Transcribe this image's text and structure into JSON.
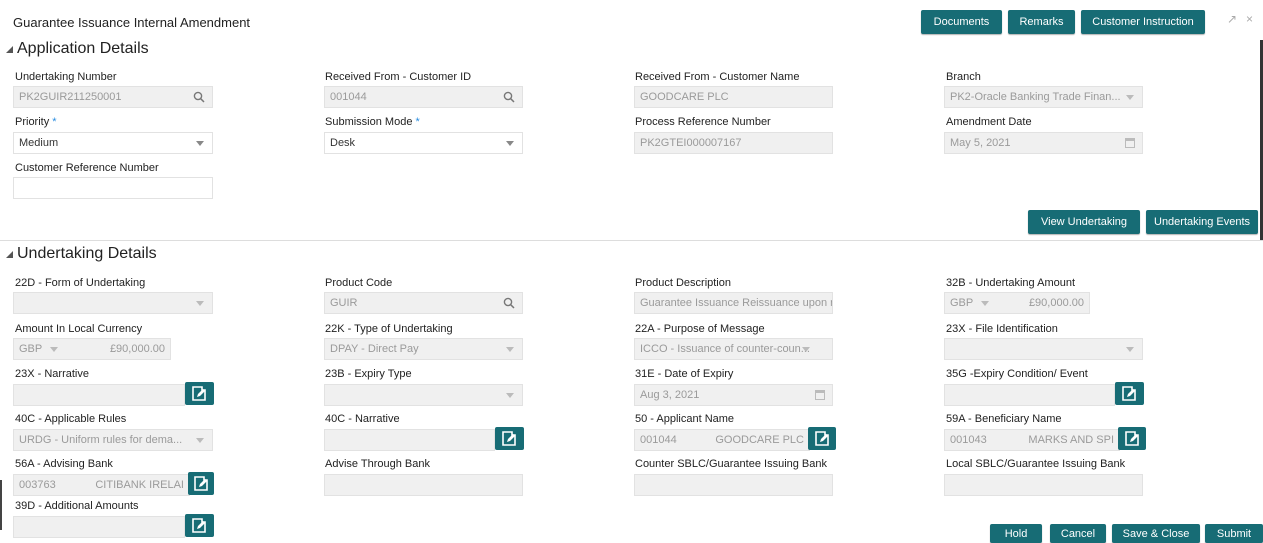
{
  "header": {
    "title": "Guarantee Issuance Internal Amendment",
    "buttons": [
      "Documents",
      "Remarks",
      "Customer Instruction"
    ],
    "win_icons": [
      "↗",
      "×"
    ]
  },
  "application": {
    "section_title": "Application Details",
    "undertaking_number": {
      "label": "Undertaking Number",
      "value": "PK2GUIR211250001"
    },
    "customer_id": {
      "label": "Received From - Customer ID",
      "value": "001044"
    },
    "customer_name": {
      "label": "Received From - Customer Name",
      "value": "GOODCARE PLC"
    },
    "branch": {
      "label": "Branch",
      "value": "PK2-Oracle Banking Trade Finan..."
    },
    "priority": {
      "label": "Priority",
      "required": "*",
      "value": "Medium"
    },
    "submission_mode": {
      "label": "Submission Mode",
      "required": "*",
      "value": "Desk"
    },
    "process_ref": {
      "label": "Process Reference Number",
      "value": "PK2GTEI000007167"
    },
    "amendment_date": {
      "label": "Amendment Date",
      "value": "May 5, 2021"
    },
    "customer_ref": {
      "label": "Customer Reference Number",
      "value": ""
    },
    "view_undertaking": "View Undertaking",
    "undertaking_events": "Undertaking Events"
  },
  "undertaking": {
    "section_title": "Undertaking Details",
    "form": {
      "label": "22D - Form of Undertaking",
      "value": ""
    },
    "product_code": {
      "label": "Product Code",
      "value": "GUIR"
    },
    "product_desc": {
      "label": "Product Description",
      "value": "Guarantee Issuance  Reissuance upon r"
    },
    "amount": {
      "label": "32B - Undertaking Amount",
      "currency": "GBP",
      "value": "£90,000.00"
    },
    "local_amount": {
      "label": "Amount In Local Currency",
      "currency": "GBP",
      "value": "£90,000.00"
    },
    "type": {
      "label": "22K - Type of Undertaking",
      "value": "DPAY - Direct Pay"
    },
    "purpose": {
      "label": "22A - Purpose of Message",
      "value": "ICCO - Issuance of counter-coun..."
    },
    "file_id": {
      "label": "23X - File Identification",
      "value": ""
    },
    "narrative_23x": {
      "label": "23X - Narrative"
    },
    "expiry_type": {
      "label": "23B - Expiry Type",
      "value": ""
    },
    "expiry_date": {
      "label": "31E - Date of Expiry",
      "value": "Aug 3, 2021"
    },
    "expiry_condition": {
      "label": "35G -Expiry Condition/ Event"
    },
    "rules": {
      "label": "40C - Applicable Rules",
      "value": "URDG - Uniform rules for dema..."
    },
    "narrative_40c": {
      "label": "40C - Narrative"
    },
    "applicant": {
      "label": "50 - Applicant Name",
      "id": "001044",
      "name": "GOODCARE PLC"
    },
    "beneficiary": {
      "label": "59A - Beneficiary Name",
      "id": "001043",
      "name": "MARKS AND SPI"
    },
    "advising_bank": {
      "label": "56A - Advising Bank",
      "id": "003763",
      "name": "CITIBANK IRELAI"
    },
    "advise_through": {
      "label": "Advise Through Bank"
    },
    "counter_bank": {
      "label": "Counter SBLC/Guarantee Issuing Bank"
    },
    "local_bank": {
      "label": "Local SBLC/Guarantee Issuing Bank"
    },
    "additional_amounts": {
      "label": "39D - Additional Amounts"
    }
  },
  "footer": {
    "hold": "Hold",
    "cancel": "Cancel",
    "save_close": "Save & Close",
    "submit": "Submit"
  }
}
